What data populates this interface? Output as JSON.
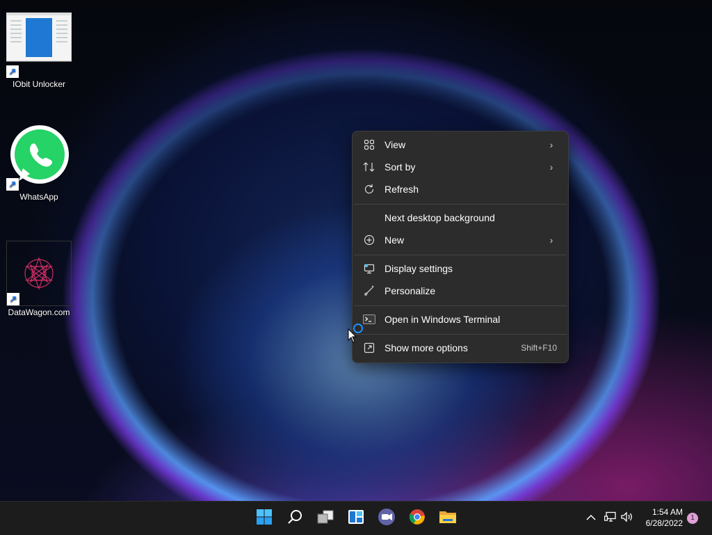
{
  "desktop": {
    "icons": [
      {
        "label": "IObit Unlocker",
        "icon": "iobit-unlocker-icon"
      },
      {
        "label": "WhatsApp",
        "icon": "whatsapp-icon"
      },
      {
        "label": "DataWagon.com",
        "icon": "datawagon-icon"
      }
    ]
  },
  "context_menu": {
    "items": [
      {
        "label": "View",
        "icon": "grid-view-icon",
        "submenu": true
      },
      {
        "label": "Sort by",
        "icon": "sort-icon",
        "submenu": true
      },
      {
        "label": "Refresh",
        "icon": "refresh-icon",
        "submenu": false
      },
      {
        "label": "Next desktop background",
        "icon": "",
        "submenu": false
      },
      {
        "label": "New",
        "icon": "plus-circle-icon",
        "submenu": true
      },
      {
        "label": "Display settings",
        "icon": "display-settings-icon",
        "submenu": false
      },
      {
        "label": "Personalize",
        "icon": "brush-icon",
        "submenu": false
      },
      {
        "label": "Open in Windows Terminal",
        "icon": "terminal-icon",
        "submenu": false
      },
      {
        "label": "Show more options",
        "icon": "show-more-icon",
        "shortcut": "Shift+F10"
      }
    ]
  },
  "taskbar": {
    "apps": [
      "start-icon",
      "search-icon",
      "task-view-icon",
      "widgets-icon",
      "teams-chat-icon",
      "chrome-icon",
      "file-explorer-icon"
    ],
    "time": "1:54 AM",
    "date": "6/28/2022",
    "notification_count": "1"
  },
  "colors": {
    "menu_bg": "#2c2c2c",
    "taskbar_bg": "#1c1c1c",
    "accent": "#4cc2ff"
  }
}
